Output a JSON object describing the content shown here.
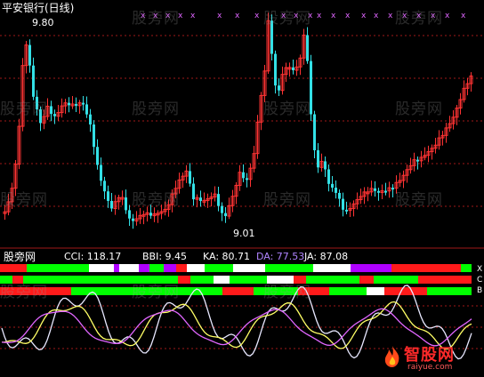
{
  "window": {
    "title": "平安银行(日线)"
  },
  "main_chart": {
    "price_high_label": "9.80",
    "price_low_label": "9.01",
    "markers_glyph": "x"
  },
  "indicator": {
    "panel_title": "股旁网",
    "cci": {
      "label": "CCI: 118.17",
      "color": "#ffffff"
    },
    "bbi": {
      "label": "BBI: 9.45",
      "color": "#ffffff"
    },
    "ka": {
      "label": "KA: 80.71",
      "color": "#ffffff"
    },
    "da": {
      "label": "DA: 77.53",
      "color": "#b084ff"
    },
    "ja": {
      "label": "JA: 87.08",
      "color": "#ffffff"
    },
    "bar_side_labels": [
      "X",
      "C",
      "B"
    ]
  },
  "watermarks": [
    "股旁网"
  ],
  "logo": {
    "brand": "智股网",
    "url_text": "raiyue.com"
  },
  "colors": {
    "up": "#ff3333",
    "down": "#33e0e6",
    "red": "#ff1a1a",
    "green": "#00ff00",
    "white": "#ffffff",
    "purple": "#b000ff",
    "yellow": "#ffff66",
    "pink": "#e066ff",
    "light": "#e8e8ff",
    "grid": "#a01818",
    "axis": "#a01818"
  }
}
